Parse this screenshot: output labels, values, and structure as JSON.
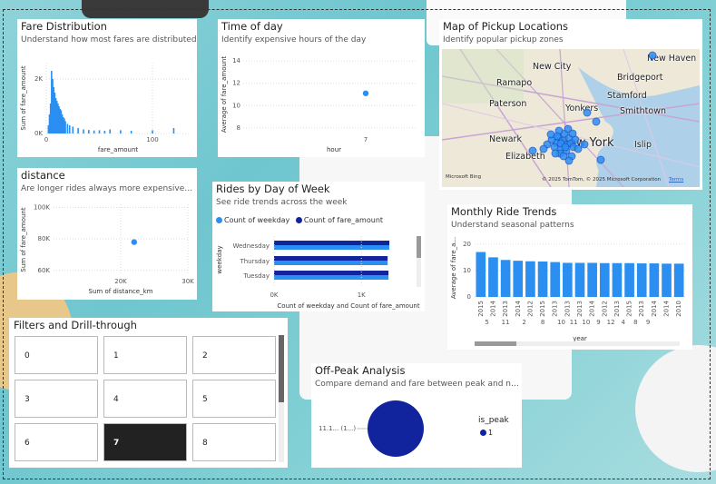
{
  "colors": {
    "accent_light": "#2a8ff0",
    "accent_dark": "#12239e",
    "selected": "#222222",
    "border": "#b9b9b9"
  },
  "fare_distribution": {
    "title": "Fare Distribution",
    "subtitle": "Understand how most fares are distributed",
    "xlabel": "fare_amount",
    "ylabel": "Sum of fare_amount",
    "y_ticks": [
      "2K",
      "0K"
    ],
    "x_ticks": [
      "0",
      "100"
    ]
  },
  "time_of_day": {
    "title": "Time of day",
    "subtitle": "Identify expensive hours of the day",
    "xlabel": "hour",
    "ylabel": "Average of fare_amount",
    "y_ticks": [
      "14",
      "12",
      "10",
      "8"
    ],
    "x_ticks": [
      "7"
    ]
  },
  "map": {
    "title": "Map of Pickup Locations",
    "subtitle": "Identify popular pickup zones",
    "labels": [
      "New City",
      "New Haven",
      "Ramapo",
      "Bridgeport",
      "Paterson",
      "Yonkers",
      "Stamford",
      "Smithtown",
      "Newark",
      "New York",
      "Islip",
      "Elizabeth"
    ],
    "bing": "Microsoft Bing",
    "copyright": "© 2025 TomTom, © 2025 Microsoft Corporation",
    "terms": "Terms"
  },
  "distance": {
    "title": "distance",
    "subtitle": "Are longer rides always more expensive? An...",
    "xlabel": "Sum of distance_km",
    "ylabel": "Sum of fare_amount",
    "y_ticks": [
      "100K",
      "80K",
      "60K"
    ],
    "x_ticks": [
      "20K",
      "30K"
    ]
  },
  "rides_by_day": {
    "title": "Rides by Day of Week",
    "subtitle": "See ride trends across the week",
    "legend": [
      "Count of weekday",
      "Count of fare_amount"
    ],
    "ylabel": "weekday",
    "xlabel": "Count of weekday and Count of fare_amount",
    "x_ticks": [
      "0K",
      "1K"
    ]
  },
  "monthly": {
    "title": "Monthly Ride Trends",
    "subtitle": "Understand seasonal patterns",
    "ylabel": "Average of fare_a...",
    "xlabel": "year",
    "y_ticks": [
      "20",
      "10",
      "0"
    ]
  },
  "filters": {
    "title": "Filters and Drill-through",
    "buttons": [
      "0",
      "1",
      "2",
      "3",
      "4",
      "5",
      "6",
      "7",
      "8"
    ],
    "selected": "7"
  },
  "offpeak": {
    "title": "Off-Peak Analysis",
    "subtitle": "Compare demand and fare between peak and non-p...",
    "pie_label": "11.1... (1...)",
    "legend_title": "is_peak",
    "legend_item": "1"
  },
  "chart_data": [
    {
      "type": "bar",
      "title": "Fare Distribution",
      "xlabel": "fare_amount",
      "ylabel": "Sum of fare_amount",
      "x": [
        2,
        3,
        4,
        5,
        6,
        7,
        8,
        9,
        10,
        11,
        12,
        13,
        14,
        15,
        16,
        17,
        18,
        20,
        22,
        25,
        30,
        35,
        40,
        45,
        50,
        55,
        60,
        70,
        80,
        100,
        120
      ],
      "values": [
        300,
        700,
        1100,
        2300,
        2000,
        1700,
        1500,
        1300,
        1200,
        1100,
        1000,
        900,
        850,
        700,
        600,
        550,
        450,
        350,
        300,
        250,
        200,
        150,
        130,
        110,
        120,
        100,
        150,
        120,
        100,
        120,
        200
      ],
      "ylim": [
        0,
        2600
      ],
      "xlim": [
        0,
        135
      ]
    },
    {
      "type": "scatter",
      "title": "Time of day",
      "xlabel": "hour",
      "ylabel": "Average of fare_amount",
      "x": [
        7
      ],
      "y": [
        11.1
      ],
      "ylim": [
        7.5,
        14.5
      ]
    },
    {
      "type": "scatter",
      "title": "distance",
      "xlabel": "Sum of distance_km",
      "ylabel": "Sum of fare_amount",
      "x": [
        22000
      ],
      "y": [
        78000
      ],
      "xlim": [
        10000,
        30000
      ],
      "ylim": [
        57000,
        102000
      ]
    },
    {
      "type": "bar",
      "title": "Rides by Day of Week",
      "categories": [
        "Wednesday",
        "Thursday",
        "Tuesday"
      ],
      "series": [
        {
          "name": "Count of weekday",
          "values": [
            1320,
            1300,
            1310
          ]
        },
        {
          "name": "Count of fare_amount",
          "values": [
            1320,
            1300,
            1310
          ]
        }
      ],
      "xlim": [
        0,
        1600
      ]
    },
    {
      "type": "bar",
      "title": "Monthly Ride Trends",
      "xlabel": "year",
      "ylabel": "Average of fare_a...",
      "categories": [
        "2015",
        "2014",
        "2013",
        "2014",
        "2012",
        "2015",
        "2013",
        "2013",
        "2013",
        "2014",
        "2012",
        "2013",
        "2015",
        "2013",
        "2014",
        "2014",
        "2010"
      ],
      "groups": [
        "5",
        "",
        "11",
        "",
        "2",
        "",
        "8",
        "10",
        "11",
        "10",
        "9",
        "12",
        "4",
        "8",
        "9"
      ],
      "values": [
        17,
        15,
        14,
        13.7,
        13.5,
        13.4,
        13.2,
        12.9,
        12.9,
        12.9,
        12.8,
        12.8,
        12.8,
        12.7,
        12.7,
        12.6,
        12.6
      ],
      "ylim": [
        0,
        22
      ]
    },
    {
      "type": "pie",
      "title": "Off-Peak Analysis",
      "categories": [
        "1"
      ],
      "values": [
        100
      ]
    }
  ]
}
